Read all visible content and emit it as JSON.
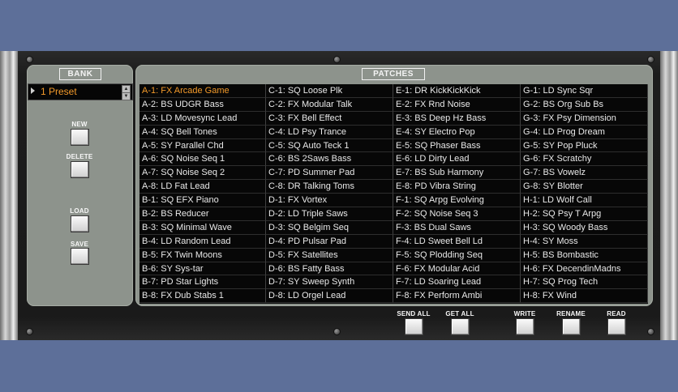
{
  "bank": {
    "header": "BANK",
    "selected_preset": "1 Preset",
    "spin_up": "▲",
    "spin_down": "▼",
    "buttons": {
      "new": "NEW",
      "delete": "DELETE",
      "load": "LOAD",
      "save": "SAVE"
    }
  },
  "patches": {
    "header": "PATCHES",
    "selected": "A-1: FX Arcade Game",
    "columns": [
      [
        "A-1: FX Arcade Game",
        "A-2: BS UDGR Bass",
        "A-3: LD Movesync Lead",
        "A-4: SQ Bell Tones",
        "A-5: SY Parallel Chd",
        "A-6: SQ Noise Seq 1",
        "A-7: SQ Noise Seq 2",
        "A-8: LD Fat Lead",
        "B-1: SQ EFX Piano",
        "B-2: BS Reducer",
        "B-3: SQ Minimal Wave",
        "B-4: LD Random Lead",
        "B-5: FX Twin Moons",
        "B-6: SY Sys-tar",
        "B-7: PD Star Lights",
        "B-8: FX Dub Stabs 1"
      ],
      [
        "C-1: SQ Loose Plk",
        "C-2: FX Modular Talk",
        "C-3: FX Bell Effect",
        "C-4: LD Psy Trance",
        "C-5: SQ Auto Teck 1",
        "C-6: BS 2Saws Bass",
        "C-7: PD Summer Pad",
        "C-8: DR Talking Toms",
        "D-1: FX Vortex",
        "D-2: LD Triple Saws",
        "D-3: SQ Belgim Seq",
        "D-4: PD Pulsar Pad",
        "D-5: FX Satellites",
        "D-6: BS Fatty Bass",
        "D-7: SY Sweep Synth",
        "D-8: LD Orgel Lead"
      ],
      [
        "E-1: DR KickKickKick",
        "E-2: FX Rnd Noise",
        "E-3: BS Deep Hz Bass",
        "E-4: SY Electro Pop",
        "E-5: SQ Phaser Bass",
        "E-6: LD Dirty Lead",
        "E-7: BS Sub Harmony",
        "E-8: PD Vibra String",
        "F-1: SQ Arpg Evolving",
        "F-2: SQ Noise Seq 3",
        "F-3: BS Dual Saws",
        "F-4: LD Sweet Bell Ld",
        "F-5: SQ Plodding Seq",
        "F-6: FX Modular Acid",
        "F-7: LD Soaring Lead",
        "F-8: FX Perform Ambi"
      ],
      [
        "G-1: LD Sync Sqr",
        "G-2: BS Org Sub Bs",
        "G-3: FX Psy Dimension",
        "G-4: LD Prog Dream",
        "G-5: SY Pop Pluck",
        "G-6: FX Scratchy",
        "G-7: BS Vowelz",
        "G-8: SY Blotter",
        "H-1: LD Wolf Call",
        "H-2: SQ Psy T Arpg",
        "H-3: SQ Woody Bass",
        "H-4: SY Moss",
        "H-5: BS Bombastic",
        "H-6: FX DecendinMadns",
        "H-7: SQ Prog Tech",
        "H-8: FX Wind"
      ]
    ]
  },
  "actions": {
    "send_all": "SEND ALL",
    "get_all": "GET ALL",
    "write": "WRITE",
    "rename": "RENAME",
    "read": "READ"
  },
  "colors": {
    "background": "#5d6f99",
    "panel": "#8d938c",
    "selected_text": "#f39a2a",
    "list_background": "#070707"
  }
}
